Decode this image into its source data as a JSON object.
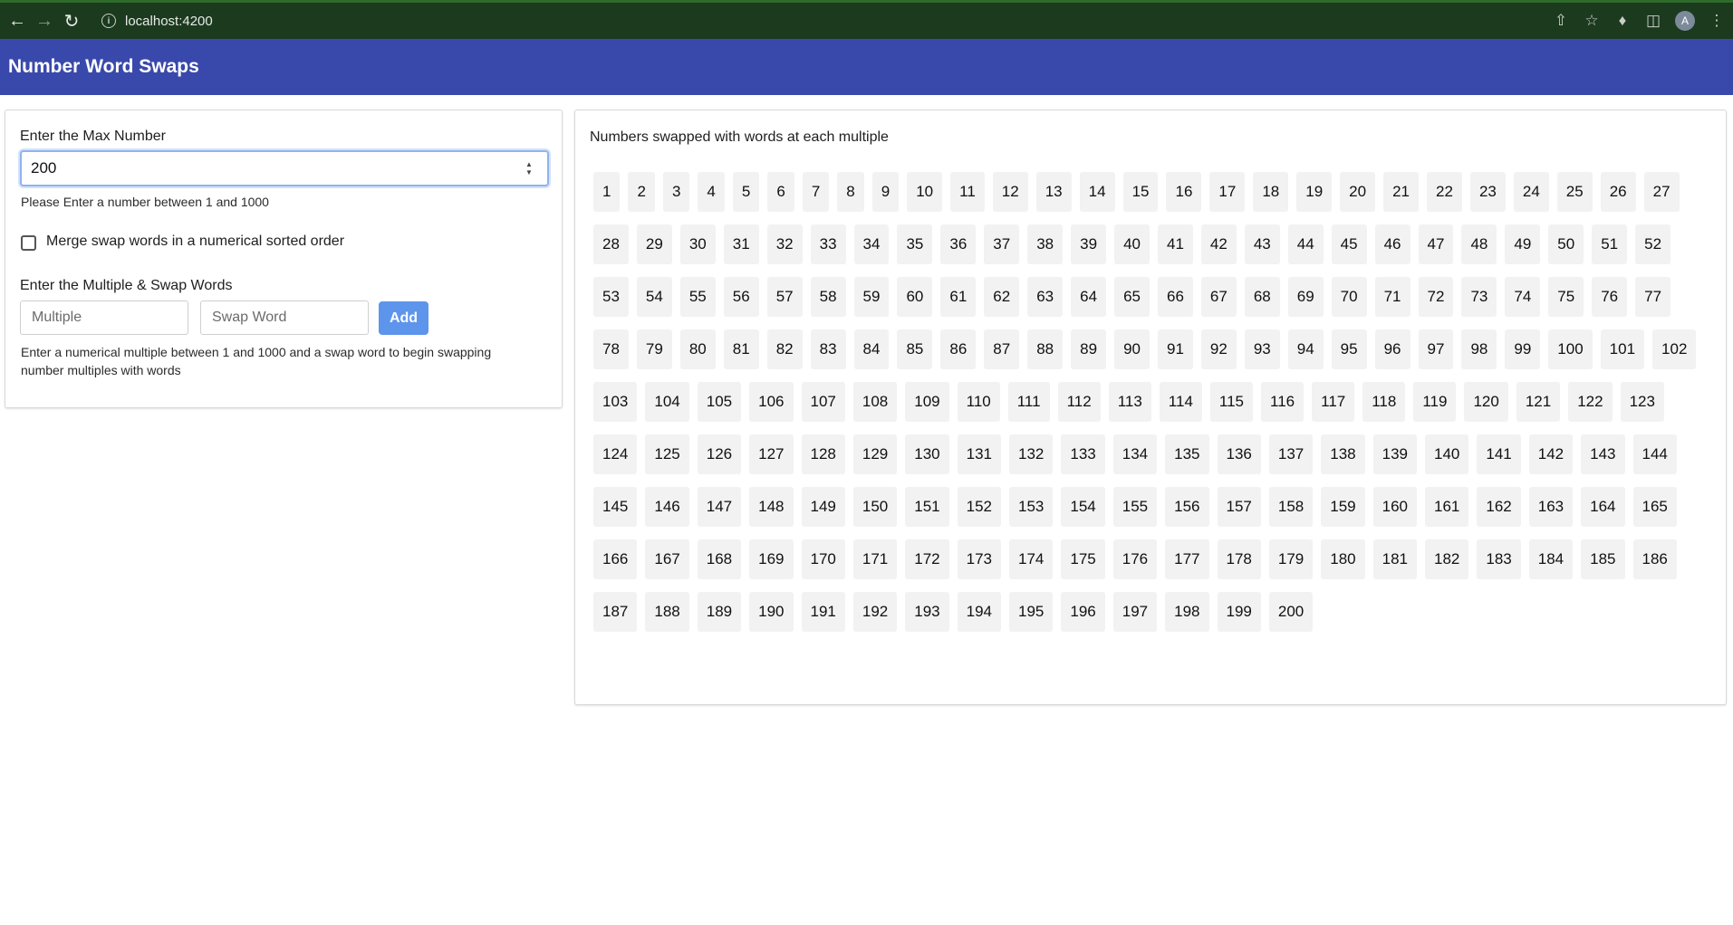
{
  "browser": {
    "url": "localhost:4200",
    "avatar_letter": "A"
  },
  "header": {
    "title": "Number Word Swaps"
  },
  "form": {
    "max_label": "Enter the Max Number",
    "max_value": "200",
    "max_help": "Please Enter a number between 1 and 1000",
    "merge_label": "Merge swap words in a numerical sorted order",
    "merge_checked": false,
    "swap_label": "Enter the Multiple & Swap Words",
    "multiple_placeholder": "Multiple",
    "swap_word_placeholder": "Swap Word",
    "add_label": "Add",
    "swap_help": "Enter a numerical multiple between 1 and 1000 and a swap word to begin swapping number multiples with words"
  },
  "results": {
    "title": "Numbers swapped with words at each multiple",
    "items": [
      "1",
      "2",
      "3",
      "4",
      "5",
      "6",
      "7",
      "8",
      "9",
      "10",
      "11",
      "12",
      "13",
      "14",
      "15",
      "16",
      "17",
      "18",
      "19",
      "20",
      "21",
      "22",
      "23",
      "24",
      "25",
      "26",
      "27",
      "28",
      "29",
      "30",
      "31",
      "32",
      "33",
      "34",
      "35",
      "36",
      "37",
      "38",
      "39",
      "40",
      "41",
      "42",
      "43",
      "44",
      "45",
      "46",
      "47",
      "48",
      "49",
      "50",
      "51",
      "52",
      "53",
      "54",
      "55",
      "56",
      "57",
      "58",
      "59",
      "60",
      "61",
      "62",
      "63",
      "64",
      "65",
      "66",
      "67",
      "68",
      "69",
      "70",
      "71",
      "72",
      "73",
      "74",
      "75",
      "76",
      "77",
      "78",
      "79",
      "80",
      "81",
      "82",
      "83",
      "84",
      "85",
      "86",
      "87",
      "88",
      "89",
      "90",
      "91",
      "92",
      "93",
      "94",
      "95",
      "96",
      "97",
      "98",
      "99",
      "100",
      "101",
      "102",
      "103",
      "104",
      "105",
      "106",
      "107",
      "108",
      "109",
      "110",
      "111",
      "112",
      "113",
      "114",
      "115",
      "116",
      "117",
      "118",
      "119",
      "120",
      "121",
      "122",
      "123",
      "124",
      "125",
      "126",
      "127",
      "128",
      "129",
      "130",
      "131",
      "132",
      "133",
      "134",
      "135",
      "136",
      "137",
      "138",
      "139",
      "140",
      "141",
      "142",
      "143",
      "144",
      "145",
      "146",
      "147",
      "148",
      "149",
      "150",
      "151",
      "152",
      "153",
      "154",
      "155",
      "156",
      "157",
      "158",
      "159",
      "160",
      "161",
      "162",
      "163",
      "164",
      "165",
      "166",
      "167",
      "168",
      "169",
      "170",
      "171",
      "172",
      "173",
      "174",
      "175",
      "176",
      "177",
      "178",
      "179",
      "180",
      "181",
      "182",
      "183",
      "184",
      "185",
      "186",
      "187",
      "188",
      "189",
      "190",
      "191",
      "192",
      "193",
      "194",
      "195",
      "196",
      "197",
      "198",
      "199",
      "200"
    ]
  },
  "icons": {
    "back": "arrow-left-icon",
    "forward": "arrow-right-icon",
    "reload": "reload-icon",
    "info": "info-icon",
    "share": "share-icon",
    "bookmark": "star-icon",
    "extensions": "puzzle-icon",
    "sidepanel": "side-panel-icon",
    "menu": "kebab-menu-icon"
  },
  "colors": {
    "header_bg": "#3949ab",
    "chrome_bg": "#1b3a1e",
    "add_button": "#5e95ec"
  }
}
